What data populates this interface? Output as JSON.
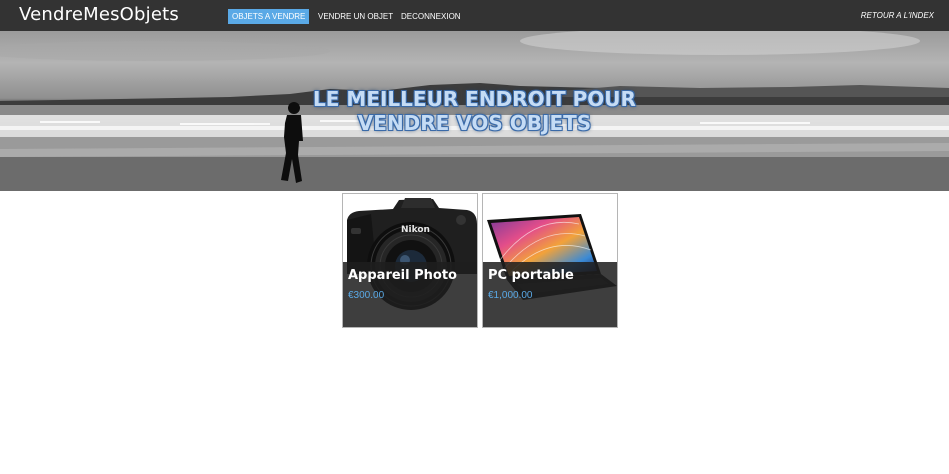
{
  "navbar": {
    "brand": "VendreMesObjets",
    "links": [
      {
        "label": "Objets a vendre",
        "active": true
      },
      {
        "label": "Vendre un objet",
        "active": false
      },
      {
        "label": "Deconnexion",
        "active": false
      }
    ],
    "right_link": "Retour a l'index"
  },
  "hero": {
    "title_line1": "Le meilleur endroit pour",
    "title_line2": "vendre vos objets"
  },
  "products": [
    {
      "title": "Appareil Photo",
      "price": "€300.00",
      "image": "camera-image"
    },
    {
      "title": "PC portable",
      "price": "€1,000.00",
      "image": "laptop-image"
    }
  ],
  "colors": {
    "navbar_bg": "#333333",
    "accent": "#5aa9e6",
    "card_overlay": "#1e1e1e"
  }
}
